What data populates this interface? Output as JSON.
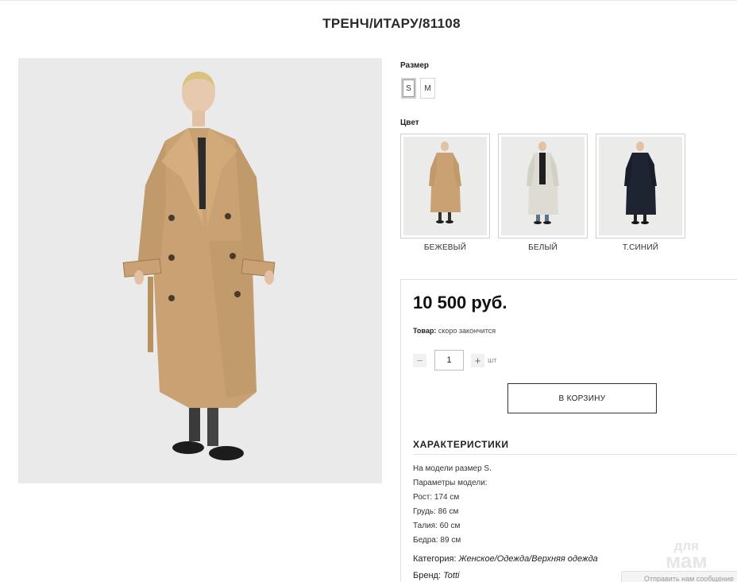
{
  "product": {
    "title": "ТРЕНЧ/ИТАРУ/81108"
  },
  "size": {
    "label": "Размер",
    "options": [
      "S",
      "M"
    ],
    "selected": "S"
  },
  "color": {
    "label": "Цвет",
    "options": [
      {
        "name": "БЕЖЕВЫЙ",
        "coat": "#c9a173"
      },
      {
        "name": "БЕЛЫЙ",
        "coat": "#dedcd2"
      },
      {
        "name": "Т.СИНИЙ",
        "coat": "#1f2433"
      }
    ]
  },
  "purchase": {
    "price": "10 500 руб.",
    "stock_label": "Товар:",
    "stock_value": "скоро закончится",
    "quantity": "1",
    "unit": "шт",
    "cart_label": "В КОРЗИНУ"
  },
  "characteristics": {
    "title": "ХАРАКТЕРИСТИКИ",
    "lines": [
      "На модели размер S.",
      "Параметры модели:",
      "Рост: 174 см",
      "Грудь: 86 см",
      "Талия: 60 см",
      "Бедра: 89 см"
    ],
    "category_label": "Категория:",
    "category_value": "Женское/Одежда/Верхняя одежда",
    "brand_label": "Бренд:",
    "brand_value": "Totti"
  },
  "watermark": {
    "line1": "для",
    "line2": "мам"
  },
  "notify_text": "Отправить нам сообщение",
  "colors": {
    "coat_main": "#c9a173",
    "photo_bg": "#ebeaea",
    "border": "#e2e2e2"
  }
}
